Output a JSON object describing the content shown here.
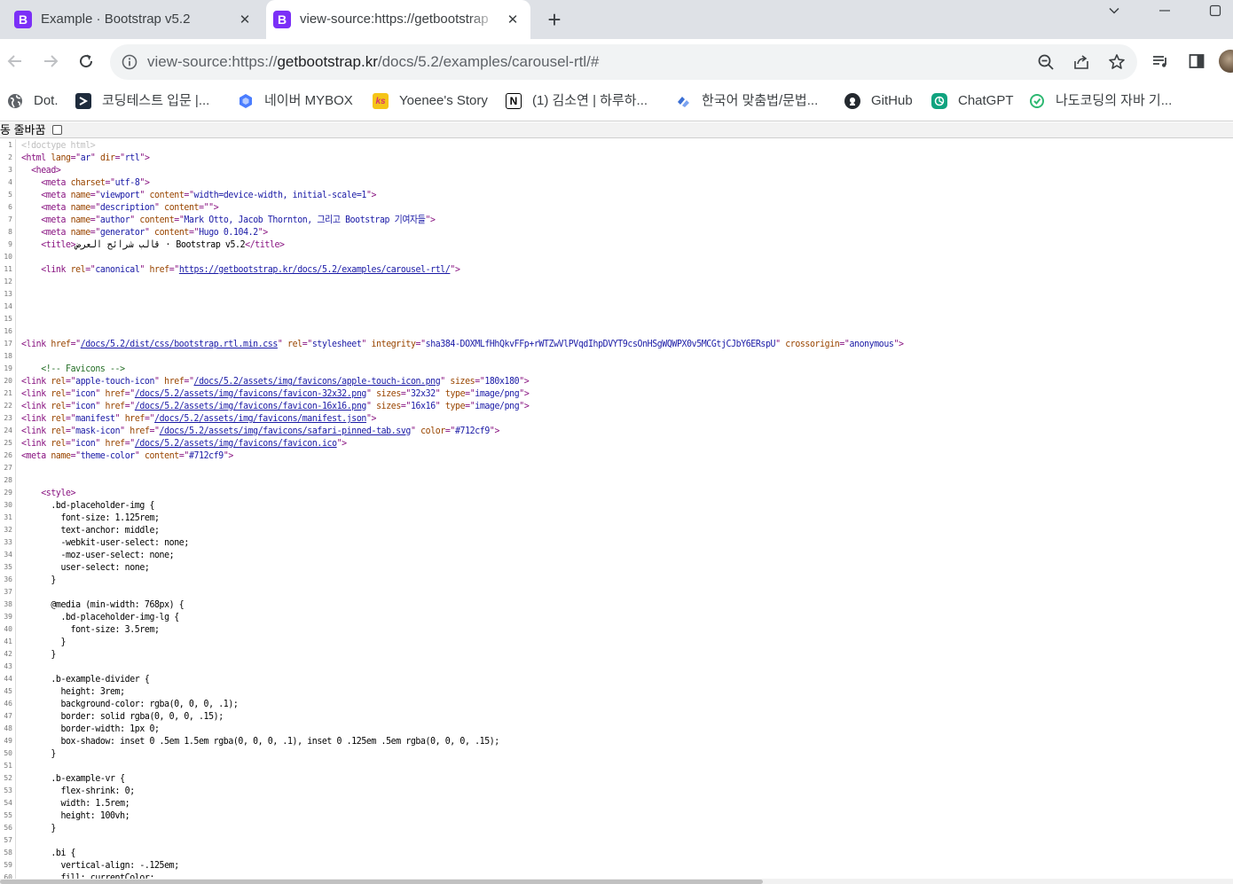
{
  "browser": {
    "tabs": [
      {
        "title": "Example · Bootstrap v5.2",
        "favicon": "B",
        "active": false
      },
      {
        "title": "view-source:https://getbootstrap",
        "favicon": "B",
        "active": true
      }
    ],
    "new_tab": "+",
    "favicon_color": "#7b2ff7",
    "address": {
      "scheme_prefix": "view-source:https://",
      "host": "getbootstrap.kr",
      "path": "/docs/5.2/examples/carousel-rtl/#"
    }
  },
  "bookmarks": [
    {
      "label": "Dot.",
      "icon": "globe-icon",
      "color": "#5f6368"
    },
    {
      "label": "코딩테스트 입문 |...",
      "icon": "programmers-icon",
      "color": "#1e2b3c"
    },
    {
      "label": "네이버 MYBOX",
      "icon": "mybox-icon",
      "color": "#4a7dff"
    },
    {
      "label": "Yoenee's Story",
      "icon": "tistory-icon",
      "color": "#f5c518"
    },
    {
      "label": "(1) 김소연 | 하루하...",
      "icon": "notion-icon",
      "color": "#000000"
    },
    {
      "label": "한국어 맞춤법/문법...",
      "icon": "spellcheck-icon",
      "color": "#3b6fd4"
    },
    {
      "label": "GitHub",
      "icon": "github-icon",
      "color": "#24292f"
    },
    {
      "label": "ChatGPT",
      "icon": "chatgpt-icon",
      "color": "#10a37f"
    },
    {
      "label": "나도코딩의 자바 기...",
      "icon": "nadocoding-icon",
      "color": "#2eb872"
    }
  ],
  "viewsource": {
    "wrap_label": "동 줄바꿈",
    "wrap_checked": false
  },
  "source_lines": [
    [
      [
        "dt",
        "<!doctype html>"
      ]
    ],
    [
      [
        "t",
        "<html "
      ],
      [
        "a",
        "lang"
      ],
      [
        "t",
        "=\""
      ],
      [
        "v",
        "ar"
      ],
      [
        "t",
        "\" "
      ],
      [
        "a",
        "dir"
      ],
      [
        "t",
        "=\""
      ],
      [
        "v",
        "rtl"
      ],
      [
        "t",
        "\">"
      ]
    ],
    [
      [
        "",
        "  "
      ],
      [
        "t",
        "<head>"
      ]
    ],
    [
      [
        "",
        "    "
      ],
      [
        "t",
        "<meta "
      ],
      [
        "a",
        "charset"
      ],
      [
        "t",
        "=\""
      ],
      [
        "v",
        "utf-8"
      ],
      [
        "t",
        "\">"
      ]
    ],
    [
      [
        "",
        "    "
      ],
      [
        "t",
        "<meta "
      ],
      [
        "a",
        "name"
      ],
      [
        "t",
        "=\""
      ],
      [
        "v",
        "viewport"
      ],
      [
        "t",
        "\" "
      ],
      [
        "a",
        "content"
      ],
      [
        "t",
        "=\""
      ],
      [
        "v",
        "width=device-width, initial-scale=1"
      ],
      [
        "t",
        "\">"
      ]
    ],
    [
      [
        "",
        "    "
      ],
      [
        "t",
        "<meta "
      ],
      [
        "a",
        "name"
      ],
      [
        "t",
        "=\""
      ],
      [
        "v",
        "description"
      ],
      [
        "t",
        "\" "
      ],
      [
        "a",
        "content"
      ],
      [
        "t",
        "=\"\">"
      ]
    ],
    [
      [
        "",
        "    "
      ],
      [
        "t",
        "<meta "
      ],
      [
        "a",
        "name"
      ],
      [
        "t",
        "=\""
      ],
      [
        "v",
        "author"
      ],
      [
        "t",
        "\" "
      ],
      [
        "a",
        "content"
      ],
      [
        "t",
        "=\""
      ],
      [
        "v",
        "Mark Otto, Jacob Thornton, 그리고 Bootstrap 기여자들"
      ],
      [
        "t",
        "\">"
      ]
    ],
    [
      [
        "",
        "    "
      ],
      [
        "t",
        "<meta "
      ],
      [
        "a",
        "name"
      ],
      [
        "t",
        "=\""
      ],
      [
        "v",
        "generator"
      ],
      [
        "t",
        "\" "
      ],
      [
        "a",
        "content"
      ],
      [
        "t",
        "=\""
      ],
      [
        "v",
        "Hugo 0.104.2"
      ],
      [
        "t",
        "\">"
      ]
    ],
    [
      [
        "",
        "    "
      ],
      [
        "t",
        "<title>"
      ],
      [
        "",
        "قالب شرائح العرض · Bootstrap v5.2"
      ],
      [
        "t",
        "</title>"
      ]
    ],
    [],
    [
      [
        "",
        "    "
      ],
      [
        "t",
        "<link "
      ],
      [
        "a",
        "rel"
      ],
      [
        "t",
        "=\""
      ],
      [
        "v",
        "canonical"
      ],
      [
        "t",
        "\" "
      ],
      [
        "a",
        "href"
      ],
      [
        "t",
        "=\""
      ],
      [
        "lk",
        "https://getbootstrap.kr/docs/5.2/examples/carousel-rtl/"
      ],
      [
        "t",
        "\">"
      ]
    ],
    [],
    [],
    [],
    [],
    [],
    [
      [
        "t",
        "<link "
      ],
      [
        "a",
        "href"
      ],
      [
        "t",
        "=\""
      ],
      [
        "lk",
        "/docs/5.2/dist/css/bootstrap.rtl.min.css"
      ],
      [
        "t",
        "\" "
      ],
      [
        "a",
        "rel"
      ],
      [
        "t",
        "=\""
      ],
      [
        "v",
        "stylesheet"
      ],
      [
        "t",
        "\" "
      ],
      [
        "a",
        "integrity"
      ],
      [
        "t",
        "=\""
      ],
      [
        "v",
        "sha384-DOXMLfHhQkvFFp+rWTZwVlPVqdIhpDVYT9csOnHSgWQWPX0v5MCGtjCJbY6ERspU"
      ],
      [
        "t",
        "\" "
      ],
      [
        "a",
        "crossorigin"
      ],
      [
        "t",
        "=\""
      ],
      [
        "v",
        "anonymous"
      ],
      [
        "t",
        "\">"
      ]
    ],
    [],
    [
      [
        "",
        "    "
      ],
      [
        "cm",
        "<!-- Favicons -->"
      ]
    ],
    [
      [
        "t",
        "<link "
      ],
      [
        "a",
        "rel"
      ],
      [
        "t",
        "=\""
      ],
      [
        "v",
        "apple-touch-icon"
      ],
      [
        "t",
        "\" "
      ],
      [
        "a",
        "href"
      ],
      [
        "t",
        "=\""
      ],
      [
        "lk",
        "/docs/5.2/assets/img/favicons/apple-touch-icon.png"
      ],
      [
        "t",
        "\" "
      ],
      [
        "a",
        "sizes"
      ],
      [
        "t",
        "=\""
      ],
      [
        "v",
        "180x180"
      ],
      [
        "t",
        "\">"
      ]
    ],
    [
      [
        "t",
        "<link "
      ],
      [
        "a",
        "rel"
      ],
      [
        "t",
        "=\""
      ],
      [
        "v",
        "icon"
      ],
      [
        "t",
        "\" "
      ],
      [
        "a",
        "href"
      ],
      [
        "t",
        "=\""
      ],
      [
        "lk",
        "/docs/5.2/assets/img/favicons/favicon-32x32.png"
      ],
      [
        "t",
        "\" "
      ],
      [
        "a",
        "sizes"
      ],
      [
        "t",
        "=\""
      ],
      [
        "v",
        "32x32"
      ],
      [
        "t",
        "\" "
      ],
      [
        "a",
        "type"
      ],
      [
        "t",
        "=\""
      ],
      [
        "v",
        "image/png"
      ],
      [
        "t",
        "\">"
      ]
    ],
    [
      [
        "t",
        "<link "
      ],
      [
        "a",
        "rel"
      ],
      [
        "t",
        "=\""
      ],
      [
        "v",
        "icon"
      ],
      [
        "t",
        "\" "
      ],
      [
        "a",
        "href"
      ],
      [
        "t",
        "=\""
      ],
      [
        "lk",
        "/docs/5.2/assets/img/favicons/favicon-16x16.png"
      ],
      [
        "t",
        "\" "
      ],
      [
        "a",
        "sizes"
      ],
      [
        "t",
        "=\""
      ],
      [
        "v",
        "16x16"
      ],
      [
        "t",
        "\" "
      ],
      [
        "a",
        "type"
      ],
      [
        "t",
        "=\""
      ],
      [
        "v",
        "image/png"
      ],
      [
        "t",
        "\">"
      ]
    ],
    [
      [
        "t",
        "<link "
      ],
      [
        "a",
        "rel"
      ],
      [
        "t",
        "=\""
      ],
      [
        "v",
        "manifest"
      ],
      [
        "t",
        "\" "
      ],
      [
        "a",
        "href"
      ],
      [
        "t",
        "=\""
      ],
      [
        "lk",
        "/docs/5.2/assets/img/favicons/manifest.json"
      ],
      [
        "t",
        "\">"
      ]
    ],
    [
      [
        "t",
        "<link "
      ],
      [
        "a",
        "rel"
      ],
      [
        "t",
        "=\""
      ],
      [
        "v",
        "mask-icon"
      ],
      [
        "t",
        "\" "
      ],
      [
        "a",
        "href"
      ],
      [
        "t",
        "=\""
      ],
      [
        "lk",
        "/docs/5.2/assets/img/favicons/safari-pinned-tab.svg"
      ],
      [
        "t",
        "\" "
      ],
      [
        "a",
        "color"
      ],
      [
        "t",
        "=\""
      ],
      [
        "v",
        "#712cf9"
      ],
      [
        "t",
        "\">"
      ]
    ],
    [
      [
        "t",
        "<link "
      ],
      [
        "a",
        "rel"
      ],
      [
        "t",
        "=\""
      ],
      [
        "v",
        "icon"
      ],
      [
        "t",
        "\" "
      ],
      [
        "a",
        "href"
      ],
      [
        "t",
        "=\""
      ],
      [
        "lk",
        "/docs/5.2/assets/img/favicons/favicon.ico"
      ],
      [
        "t",
        "\">"
      ]
    ],
    [
      [
        "t",
        "<meta "
      ],
      [
        "a",
        "name"
      ],
      [
        "t",
        "=\""
      ],
      [
        "v",
        "theme-color"
      ],
      [
        "t",
        "\" "
      ],
      [
        "a",
        "content"
      ],
      [
        "t",
        "=\""
      ],
      [
        "v",
        "#712cf9"
      ],
      [
        "t",
        "\">"
      ]
    ],
    [],
    [],
    [
      [
        "",
        "    "
      ],
      [
        "t",
        "<style>"
      ]
    ],
    [
      [
        "",
        "      .bd-placeholder-img {"
      ]
    ],
    [
      [
        "",
        "        font-size: 1.125rem;"
      ]
    ],
    [
      [
        "",
        "        text-anchor: middle;"
      ]
    ],
    [
      [
        "",
        "        -webkit-user-select: none;"
      ]
    ],
    [
      [
        "",
        "        -moz-user-select: none;"
      ]
    ],
    [
      [
        "",
        "        user-select: none;"
      ]
    ],
    [
      [
        "",
        "      }"
      ]
    ],
    [],
    [
      [
        "",
        "      @media (min-width: 768px) {"
      ]
    ],
    [
      [
        "",
        "        .bd-placeholder-img-lg {"
      ]
    ],
    [
      [
        "",
        "          font-size: 3.5rem;"
      ]
    ],
    [
      [
        "",
        "        }"
      ]
    ],
    [
      [
        "",
        "      }"
      ]
    ],
    [],
    [
      [
        "",
        "      .b-example-divider {"
      ]
    ],
    [
      [
        "",
        "        height: 3rem;"
      ]
    ],
    [
      [
        "",
        "        background-color: rgba(0, 0, 0, .1);"
      ]
    ],
    [
      [
        "",
        "        border: solid rgba(0, 0, 0, .15);"
      ]
    ],
    [
      [
        "",
        "        border-width: 1px 0;"
      ]
    ],
    [
      [
        "",
        "        box-shadow: inset 0 .5em 1.5em rgba(0, 0, 0, .1), inset 0 .125em .5em rgba(0, 0, 0, .15);"
      ]
    ],
    [
      [
        "",
        "      }"
      ]
    ],
    [],
    [
      [
        "",
        "      .b-example-vr {"
      ]
    ],
    [
      [
        "",
        "        flex-shrink: 0;"
      ]
    ],
    [
      [
        "",
        "        width: 1.5rem;"
      ]
    ],
    [
      [
        "",
        "        height: 100vh;"
      ]
    ],
    [
      [
        "",
        "      }"
      ]
    ],
    [],
    [
      [
        "",
        "      .bi {"
      ]
    ],
    [
      [
        "",
        "        vertical-align: -.125em;"
      ]
    ],
    [
      [
        "",
        "        fill: currentColor;"
      ]
    ]
  ]
}
